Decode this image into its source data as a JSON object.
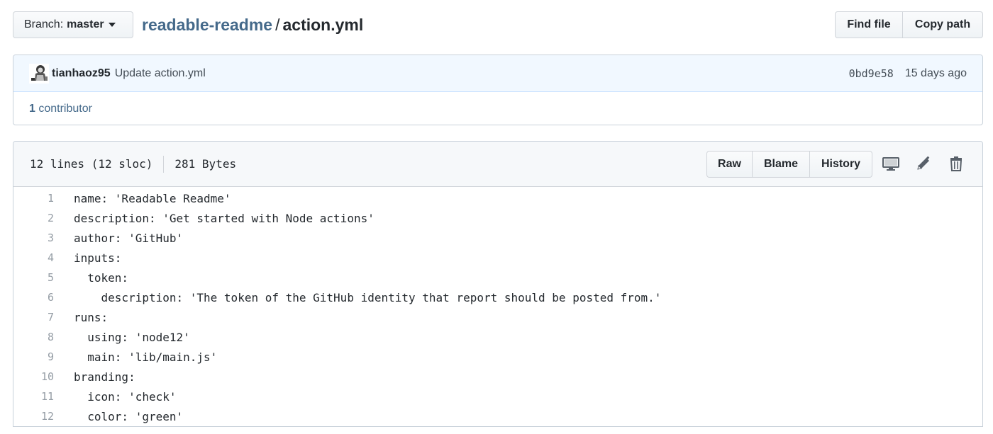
{
  "branch": {
    "label": "Branch:",
    "value": "master"
  },
  "breadcrumb": {
    "repo": "readable-readme",
    "separator": "/",
    "file": "action.yml"
  },
  "top_actions": {
    "find_file": "Find file",
    "copy_path": "Copy path"
  },
  "commit": {
    "author": "tianhaoz95",
    "message": "Update action.yml",
    "sha": "0bd9e58",
    "time_ago": "15 days ago",
    "contributors_count": "1",
    "contributors_label": "contributor"
  },
  "file_info": {
    "lines": "12 lines (12 sloc)",
    "size": "281 Bytes"
  },
  "file_actions": {
    "raw": "Raw",
    "blame": "Blame",
    "history": "History"
  },
  "icons": {
    "desktop": "desktop-icon",
    "edit": "pencil-icon",
    "delete": "trash-icon"
  },
  "code_lines": [
    {
      "num": "1",
      "text": "name: 'Readable Readme'"
    },
    {
      "num": "2",
      "text": "description: 'Get started with Node actions'"
    },
    {
      "num": "3",
      "text": "author: 'GitHub'"
    },
    {
      "num": "4",
      "text": "inputs:"
    },
    {
      "num": "5",
      "text": "  token:"
    },
    {
      "num": "6",
      "text": "    description: 'The token of the GitHub identity that report should be posted from.'"
    },
    {
      "num": "7",
      "text": "runs:"
    },
    {
      "num": "8",
      "text": "  using: 'node12'"
    },
    {
      "num": "9",
      "text": "  main: 'lib/main.js'"
    },
    {
      "num": "10",
      "text": "branding:"
    },
    {
      "num": "11",
      "text": "  icon: 'check'"
    },
    {
      "num": "12",
      "text": "  color: 'green'"
    }
  ],
  "colors": {
    "link": "#44698a",
    "commit_bg": "#f1f8ff",
    "header_bg": "#f6f8fa",
    "line_number": "#959da5"
  }
}
